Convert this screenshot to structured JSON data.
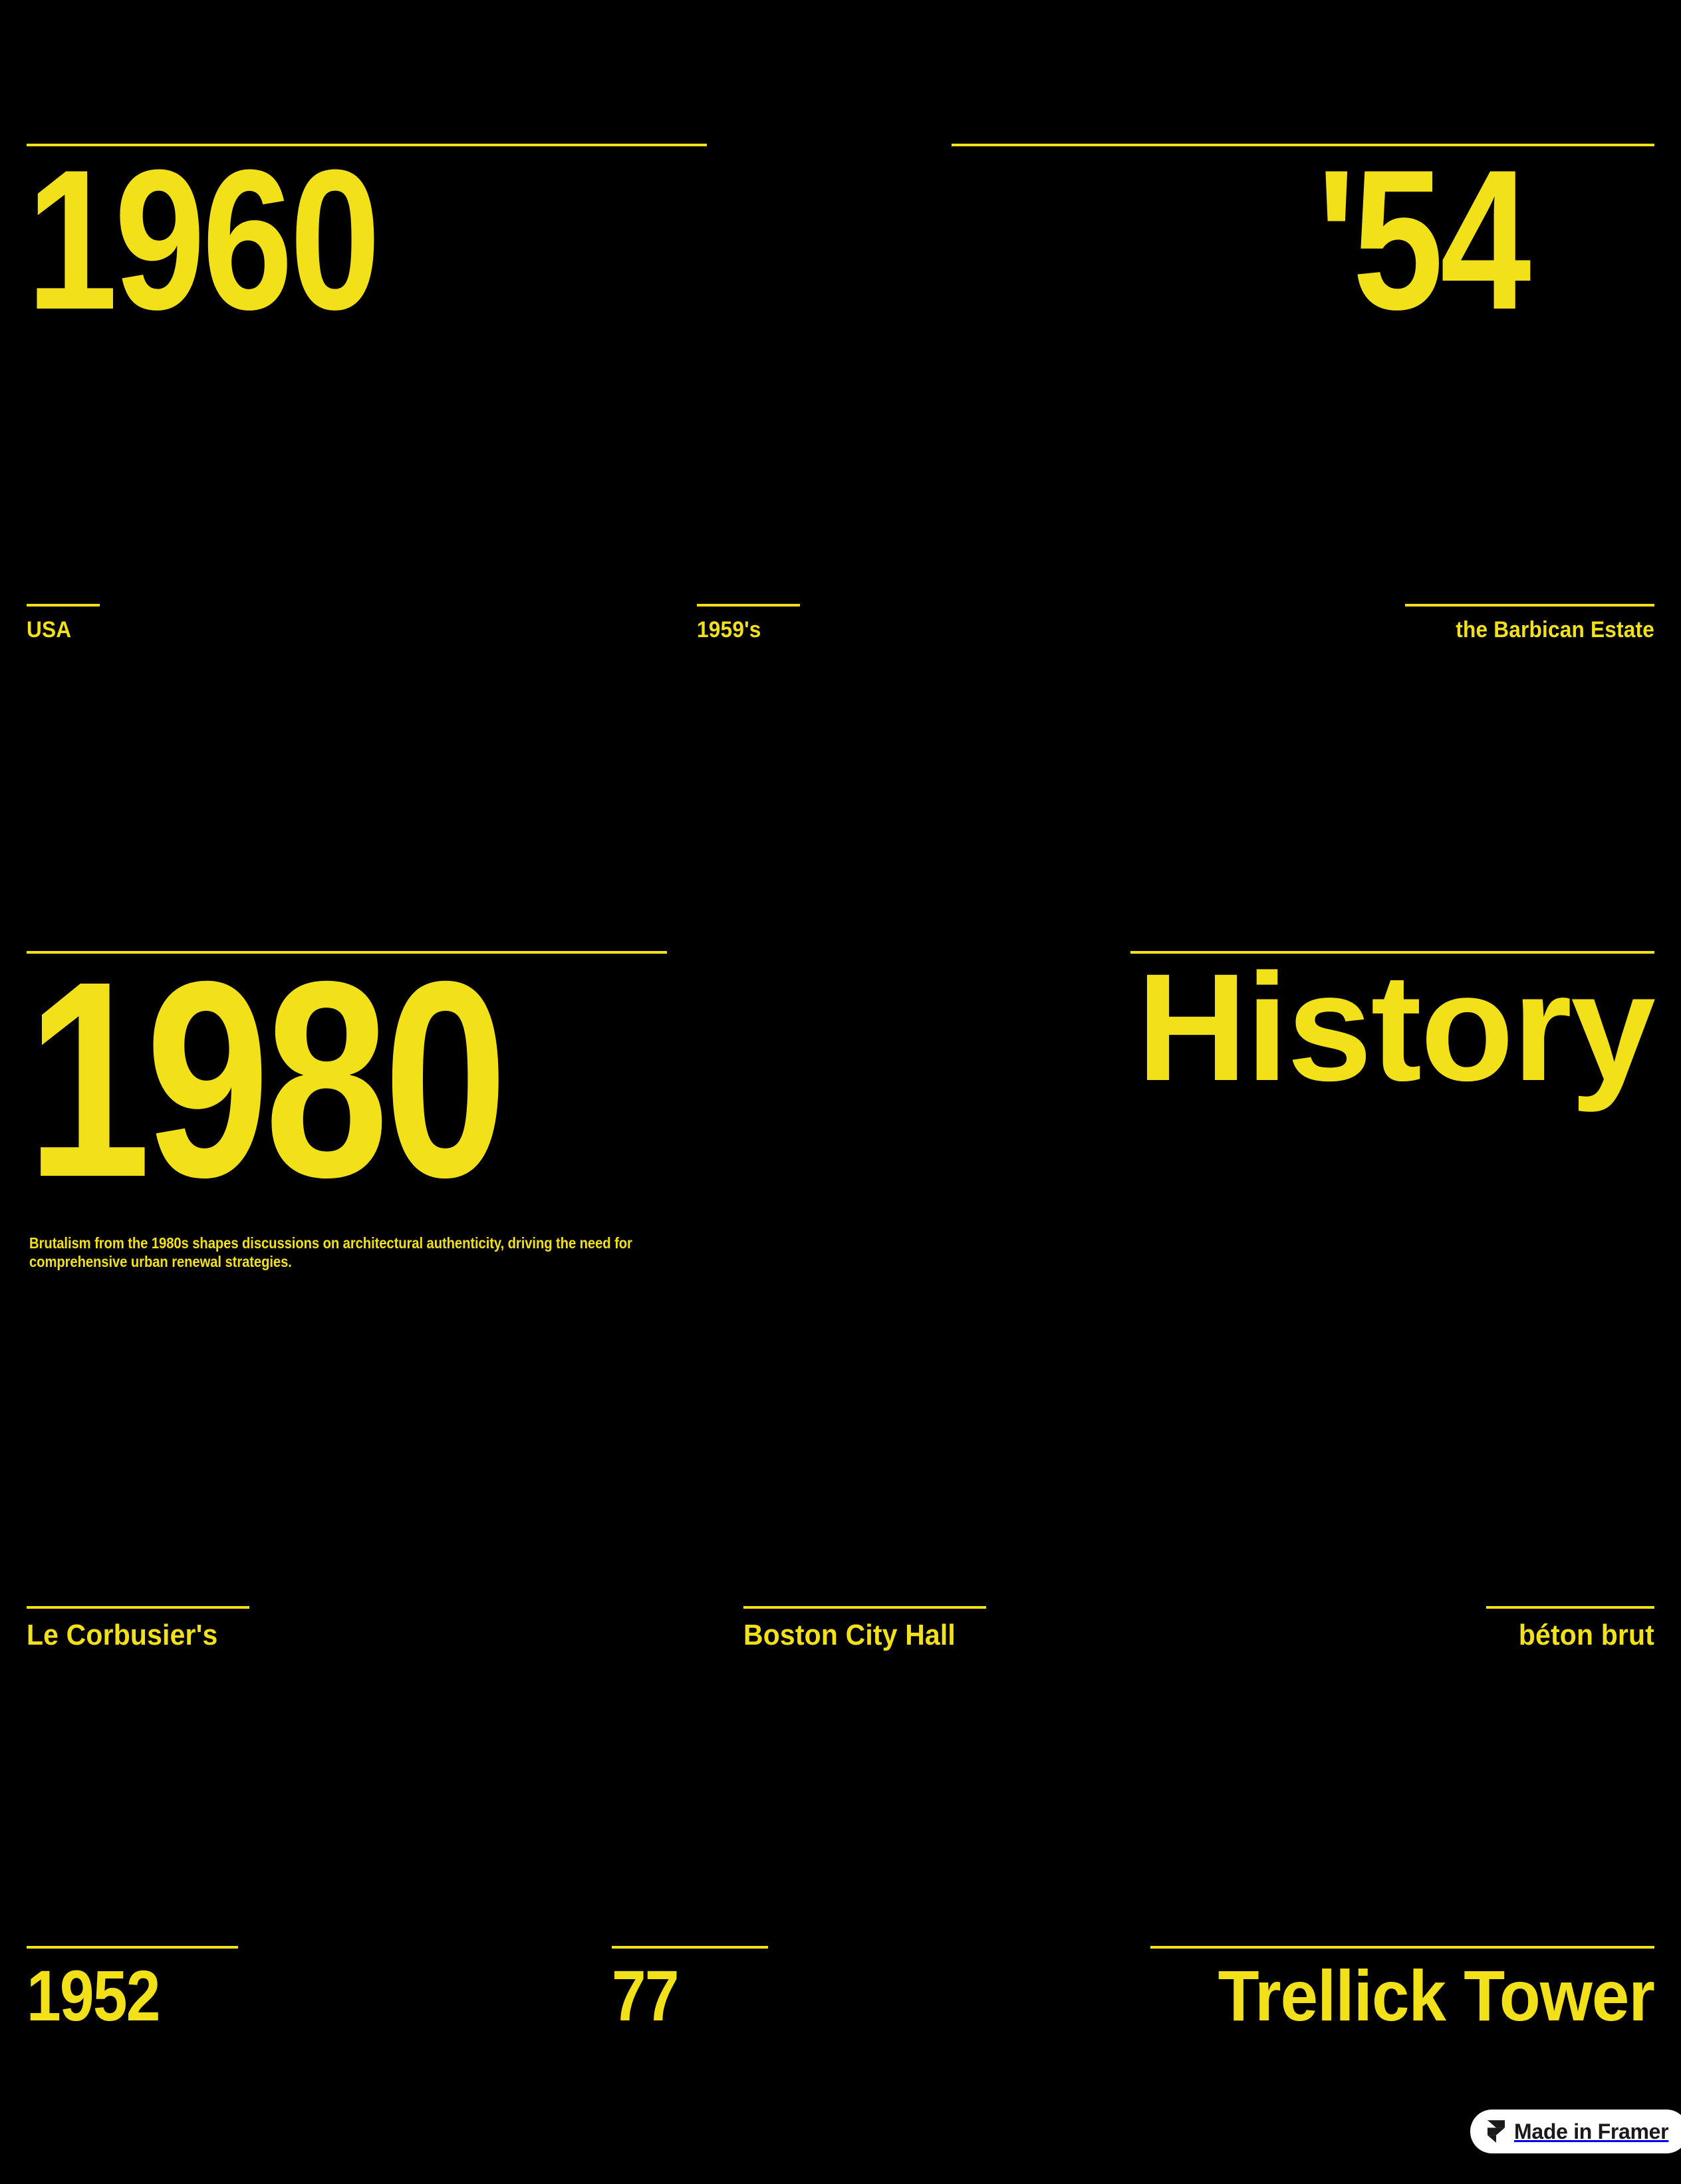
{
  "theme": {
    "background": "#000000",
    "accent": "#F2E119"
  },
  "page": {
    "title": "History"
  },
  "items": {
    "year_1960": "1960",
    "year_54": "'54",
    "label_usa": "USA",
    "label_1959s": "1959's",
    "label_barbican": "the Barbican Estate",
    "year_1980": "1980",
    "heading_history": "History",
    "paragraph_1980": "Brutalism from the 1980s shapes discussions on architectural authenticity, driving the need for comprehensive urban renewal strategies.",
    "label_le_corbusier": "Le Corbusier's",
    "label_boston_city_hall": "Boston City Hall",
    "label_beton_brut": "béton brut",
    "year_1952": "1952",
    "number_77": "77",
    "label_trellick_tower": "Trellick Tower"
  },
  "badge": {
    "icon": "framer-logo-icon",
    "label": "Made in Framer"
  }
}
